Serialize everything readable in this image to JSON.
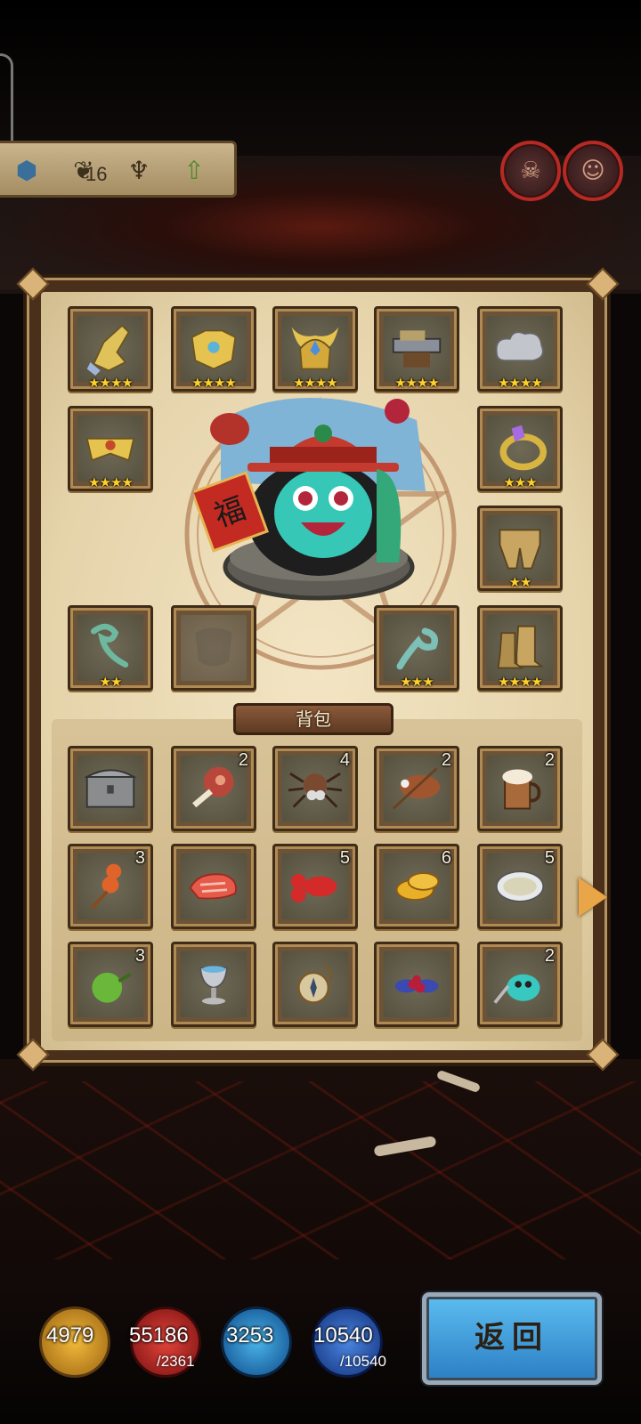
{
  "hud": {
    "level": "16",
    "icons": [
      "shield-icon",
      "wings-icon",
      "trophy-icon",
      "upgrade-arrow-icon"
    ]
  },
  "equipment": [
    {
      "name": "gauntlet",
      "stars": "★★★★"
    },
    {
      "name": "chest-armor",
      "stars": "★★★★"
    },
    {
      "name": "horned-helmet",
      "stars": "★★★★"
    },
    {
      "name": "anvil",
      "stars": "★★★★"
    },
    {
      "name": "cloud-charm",
      "stars": "★★★★"
    },
    {
      "name": "gold-belt",
      "stars": "★★★★"
    },
    {
      "name": "gem-ring",
      "stars": "★★★"
    },
    {
      "name": "leg-armor",
      "stars": "★★"
    },
    {
      "name": "ruyi-scepter",
      "stars": "★★"
    },
    {
      "name": "empty-slot",
      "stars": ""
    },
    {
      "name": "ruyi-charm",
      "stars": "★★★"
    },
    {
      "name": "boots",
      "stars": "★★★★"
    }
  ],
  "bag": {
    "title": "背包",
    "items": [
      {
        "name": "treasure-chest",
        "qty": ""
      },
      {
        "name": "meat-drumstick",
        "qty": "2"
      },
      {
        "name": "spider",
        "qty": "4"
      },
      {
        "name": "roasted-chameleon",
        "qty": "2"
      },
      {
        "name": "beer-mug",
        "qty": "2"
      },
      {
        "name": "orange-fruit-stick",
        "qty": "3"
      },
      {
        "name": "salmon-steak",
        "qty": ""
      },
      {
        "name": "red-lobster",
        "qty": "5"
      },
      {
        "name": "bread-slices",
        "qty": "6"
      },
      {
        "name": "soup-plate",
        "qty": "5"
      },
      {
        "name": "green-fruit",
        "qty": "3"
      },
      {
        "name": "silver-goblet",
        "qty": ""
      },
      {
        "name": "compass",
        "qty": ""
      },
      {
        "name": "berries",
        "qty": ""
      },
      {
        "name": "blue-fish-dagger",
        "qty": "2"
      }
    ]
  },
  "resources": [
    {
      "name": "attack",
      "value": "4979",
      "max": ""
    },
    {
      "name": "health",
      "value": "55186",
      "max": "/2361"
    },
    {
      "name": "defense",
      "value": "3253",
      "max": ""
    },
    {
      "name": "mana",
      "value": "10540",
      "max": "/10540"
    }
  ],
  "back_button": "返回",
  "colors": {
    "star": "#ffcf2a",
    "parchment": "#efe0bd",
    "frame": "#4a2f1a",
    "button_blue": "#3a95d6"
  }
}
